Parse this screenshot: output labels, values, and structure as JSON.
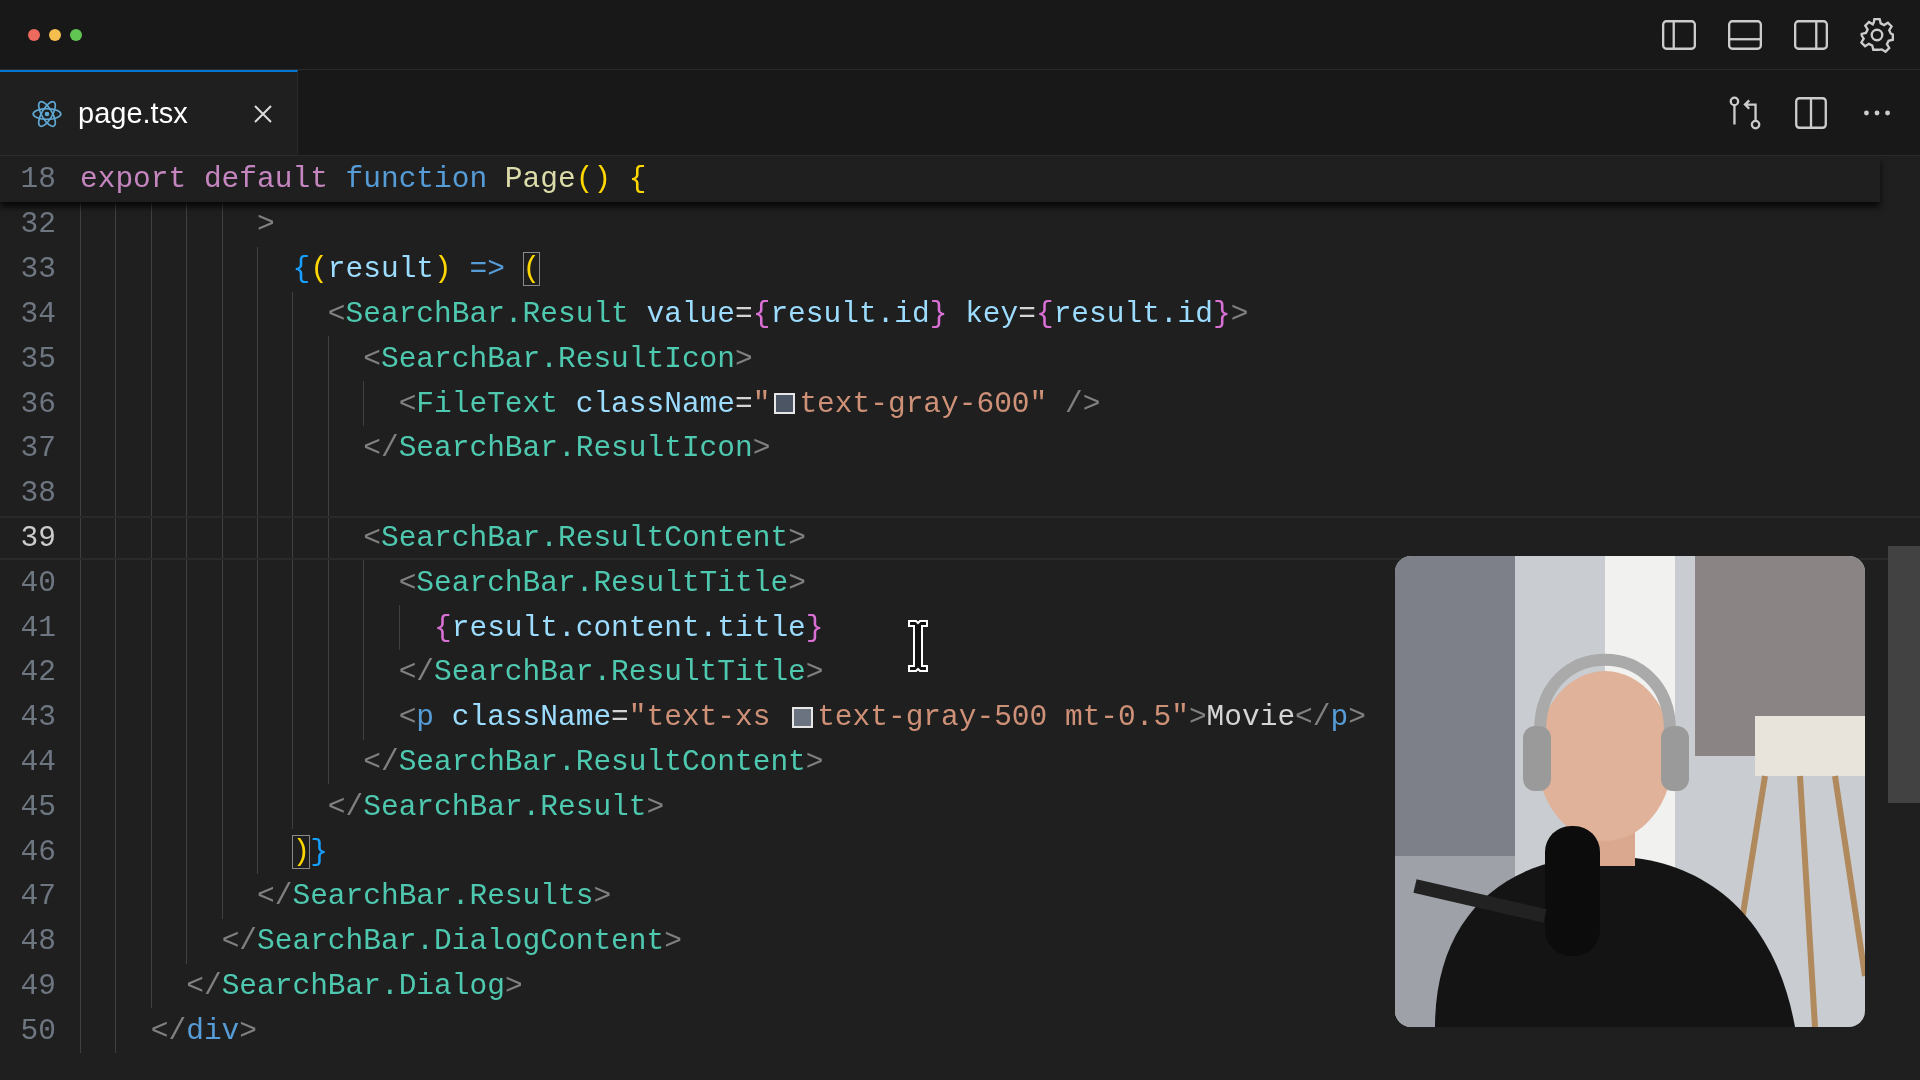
{
  "tabs": [
    {
      "label": "page.tsx",
      "selected": true
    }
  ],
  "sticky_line": {
    "number": "18",
    "segments": [
      {
        "kind": "code",
        "tokens": [
          {
            "t": "export",
            "kind": "keyword"
          },
          {
            "t": " default",
            "kind": "keyword"
          },
          {
            "t": " function",
            "kind": "storage"
          },
          {
            "t": " Page",
            "kind": "function"
          },
          {
            "t": "()",
            "kind": "bracket1"
          },
          {
            "t": " {",
            "kind": "bracket1"
          }
        ]
      }
    ]
  },
  "lines": [
    {
      "number": "32",
      "current": false,
      "segments": [
        {
          "kind": "code",
          "tokens": [
            {
              "t": "          >",
              "kind": "punct"
            }
          ]
        }
      ]
    },
    {
      "number": "33",
      "current": false,
      "segments": [
        {
          "kind": "code",
          "tokens": [
            {
              "t": "            {",
              "kind": "bracket3"
            },
            {
              "t": "(",
              "kind": "bracket1"
            },
            {
              "t": "result",
              "kind": "variable"
            },
            {
              "t": ")",
              "kind": "bracket1"
            },
            {
              "t": " =>",
              "kind": "storage"
            },
            {
              "t": " (",
              "kind": "match"
            }
          ]
        }
      ]
    },
    {
      "number": "34",
      "current": false,
      "segments": [
        {
          "kind": "code",
          "tokens": [
            {
              "t": "              <",
              "kind": "punct"
            },
            {
              "t": "SearchBar.Result",
              "kind": "component"
            },
            {
              "t": " value",
              "kind": "attribute"
            },
            {
              "t": "=",
              "kind": "operator"
            },
            {
              "t": "{",
              "kind": "bracket2"
            },
            {
              "t": "result.id",
              "kind": "variable"
            },
            {
              "t": "}",
              "kind": "bracket2"
            },
            {
              "t": " key",
              "kind": "attribute"
            },
            {
              "t": "=",
              "kind": "operator"
            },
            {
              "t": "{",
              "kind": "bracket2"
            },
            {
              "t": "result.id",
              "kind": "variable"
            },
            {
              "t": "}",
              "kind": "bracket2"
            },
            {
              "t": ">",
              "kind": "punct"
            }
          ]
        }
      ]
    },
    {
      "number": "35",
      "current": false,
      "segments": [
        {
          "kind": "code",
          "tokens": [
            {
              "t": "                <",
              "kind": "punct"
            },
            {
              "t": "SearchBar.ResultIcon",
              "kind": "component"
            },
            {
              "t": ">",
              "kind": "punct"
            }
          ]
        }
      ]
    },
    {
      "number": "36",
      "current": false,
      "segments": [
        {
          "kind": "code",
          "tokens": [
            {
              "t": "                  <",
              "kind": "punct"
            },
            {
              "t": "FileText",
              "kind": "component"
            },
            {
              "t": " className",
              "kind": "attribute"
            },
            {
              "t": "=",
              "kind": "operator"
            },
            {
              "t": "\"",
              "kind": "string"
            }
          ]
        },
        {
          "kind": "swatch",
          "color": "#4b5563"
        },
        {
          "kind": "code",
          "tokens": [
            {
              "t": "text-gray-600\"",
              "kind": "string"
            },
            {
              "t": " />",
              "kind": "punct"
            }
          ]
        }
      ]
    },
    {
      "number": "37",
      "current": false,
      "segments": [
        {
          "kind": "code",
          "tokens": [
            {
              "t": "                </",
              "kind": "punct"
            },
            {
              "t": "SearchBar.ResultIcon",
              "kind": "component"
            },
            {
              "t": ">",
              "kind": "punct"
            }
          ]
        }
      ]
    },
    {
      "number": "38",
      "current": false
    },
    {
      "number": "39",
      "current": true,
      "segments": [
        {
          "kind": "code",
          "tokens": [
            {
              "t": "                <",
              "kind": "punct"
            },
            {
              "t": "SearchBar.ResultContent",
              "kind": "component"
            },
            {
              "t": ">",
              "kind": "punct"
            }
          ]
        }
      ]
    },
    {
      "number": "40",
      "current": false,
      "segments": [
        {
          "kind": "code",
          "tokens": [
            {
              "t": "                  <",
              "kind": "punct"
            },
            {
              "t": "SearchBar.ResultTitle",
              "kind": "component"
            },
            {
              "t": ">",
              "kind": "punct"
            }
          ]
        }
      ]
    },
    {
      "number": "41",
      "current": false,
      "segments": [
        {
          "kind": "code",
          "tokens": [
            {
              "t": "                    {",
              "kind": "bracket2"
            },
            {
              "t": "result.content.title",
              "kind": "variable"
            },
            {
              "t": "}",
              "kind": "bracket2"
            }
          ]
        }
      ]
    },
    {
      "number": "42",
      "current": false,
      "segments": [
        {
          "kind": "code",
          "tokens": [
            {
              "t": "                  </",
              "kind": "punct"
            },
            {
              "t": "SearchBar.ResultTitle",
              "kind": "component"
            },
            {
              "t": ">",
              "kind": "punct"
            }
          ]
        }
      ]
    },
    {
      "number": "43",
      "current": false,
      "segments": [
        {
          "kind": "code",
          "tokens": [
            {
              "t": "                  <",
              "kind": "punct"
            },
            {
              "t": "p",
              "kind": "html"
            },
            {
              "t": " className",
              "kind": "attribute"
            },
            {
              "t": "=",
              "kind": "operator"
            },
            {
              "t": "\"text-xs ",
              "kind": "string"
            }
          ]
        },
        {
          "kind": "swatch",
          "color": "#6b7280"
        },
        {
          "kind": "code",
          "tokens": [
            {
              "t": "text-gray-500 mt-0.5\"",
              "kind": "string"
            },
            {
              "t": ">",
              "kind": "punct"
            },
            {
              "t": "Movie",
              "kind": "text"
            },
            {
              "t": "</",
              "kind": "punct"
            },
            {
              "t": "p",
              "kind": "html"
            },
            {
              "t": ">",
              "kind": "punct"
            }
          ]
        }
      ]
    },
    {
      "number": "44",
      "current": false,
      "segments": [
        {
          "kind": "code",
          "tokens": [
            {
              "t": "                </",
              "kind": "punct"
            },
            {
              "t": "SearchBar.ResultContent",
              "kind": "component"
            },
            {
              "t": ">",
              "kind": "punct"
            }
          ]
        }
      ]
    },
    {
      "number": "45",
      "current": false,
      "segments": [
        {
          "kind": "code",
          "tokens": [
            {
              "t": "              </",
              "kind": "punct"
            },
            {
              "t": "SearchBar.Result",
              "kind": "component"
            },
            {
              "t": ">",
              "kind": "punct"
            }
          ]
        }
      ]
    },
    {
      "number": "46",
      "current": false,
      "segments": [
        {
          "kind": "code",
          "tokens": [
            {
              "t": "            )",
              "kind": "match"
            },
            {
              "t": "}",
              "kind": "bracket3"
            }
          ]
        }
      ]
    },
    {
      "number": "47",
      "current": false,
      "segments": [
        {
          "kind": "code",
          "tokens": [
            {
              "t": "          </",
              "kind": "punct"
            },
            {
              "t": "SearchBar.Results",
              "kind": "component"
            },
            {
              "t": ">",
              "kind": "punct"
            }
          ]
        }
      ]
    },
    {
      "number": "48",
      "current": false,
      "segments": [
        {
          "kind": "code",
          "tokens": [
            {
              "t": "        </",
              "kind": "punct"
            },
            {
              "t": "SearchBar.DialogContent",
              "kind": "component"
            },
            {
              "t": ">",
              "kind": "punct"
            }
          ]
        }
      ]
    },
    {
      "number": "49",
      "current": false,
      "segments": [
        {
          "kind": "code",
          "tokens": [
            {
              "t": "      </",
              "kind": "punct"
            },
            {
              "t": "SearchBar.Dialog",
              "kind": "component"
            },
            {
              "t": ">",
              "kind": "punct"
            }
          ]
        }
      ]
    },
    {
      "number": "50",
      "current": false,
      "segments": [
        {
          "kind": "code",
          "tokens": [
            {
              "t": "    </",
              "kind": "punct"
            },
            {
              "t": "div",
              "kind": "html"
            },
            {
              "t": ">",
              "kind": "punct"
            }
          ]
        }
      ]
    }
  ]
}
